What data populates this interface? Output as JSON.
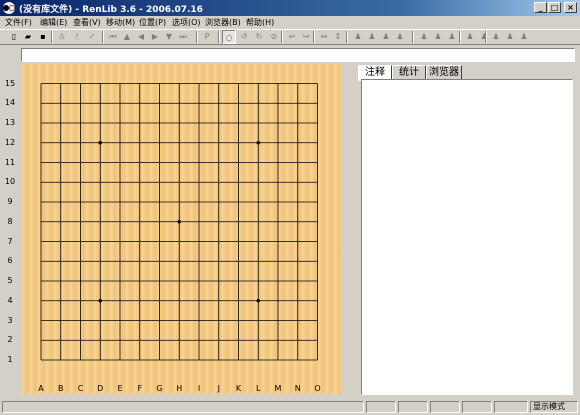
{
  "window": {
    "title": "(没有库文件) - RenLib 3.6 - 2006.07.16"
  },
  "caption_buttons": {
    "minimize": "_",
    "maximize": "□",
    "close": "×"
  },
  "menu": [
    {
      "label": "文件(F)"
    },
    {
      "label": "编辑(E)"
    },
    {
      "label": "查看(V)"
    },
    {
      "label": "移动(M)"
    },
    {
      "label": "位置(P)"
    },
    {
      "label": "选项(O)"
    },
    {
      "label": "浏览器(B)"
    },
    {
      "label": "帮助(H)"
    }
  ],
  "toolbar": {
    "buttons": [
      {
        "icon": "new-file-icon",
        "glyph": "▯",
        "active": true
      },
      {
        "icon": "open-folder-icon",
        "glyph": "▰",
        "active": true
      },
      {
        "icon": "save-disk-icon",
        "glyph": "▪",
        "active": true
      },
      {
        "icon": "black-stone-move-icon",
        "glyph": "♙",
        "active": false
      },
      {
        "icon": "exclamation-icon",
        "glyph": "!",
        "active": false
      },
      {
        "icon": "checkmark-icon",
        "glyph": "✓",
        "active": false
      },
      {
        "icon": "first-move-icon",
        "glyph": "⏮",
        "active": false
      },
      {
        "icon": "arrow-up-icon",
        "glyph": "▲",
        "active": false
      },
      {
        "icon": "arrow-left-icon",
        "glyph": "◀",
        "active": false
      },
      {
        "icon": "arrow-right-icon",
        "glyph": "▶",
        "active": false
      },
      {
        "icon": "arrow-down-icon",
        "glyph": "▼",
        "active": false
      },
      {
        "icon": "last-move-icon",
        "glyph": "⏭",
        "active": false
      },
      {
        "icon": "position-icon",
        "glyph": "P",
        "active": false
      },
      {
        "icon": "rotate-icon",
        "glyph": "◌",
        "active": true,
        "pressed": true
      },
      {
        "icon": "rotate-ccw-icon",
        "glyph": "↺",
        "active": false
      },
      {
        "icon": "rotate-cw-icon",
        "glyph": "↻",
        "active": false
      },
      {
        "icon": "rotate-180-icon",
        "glyph": "⊘",
        "active": false
      },
      {
        "icon": "undo-icon",
        "glyph": "↩",
        "active": false
      },
      {
        "icon": "redo-icon",
        "glyph": "↪",
        "active": false
      },
      {
        "icon": "flip-horizontal-icon",
        "glyph": "↔",
        "active": false
      },
      {
        "icon": "flip-vertical-icon",
        "glyph": "↕",
        "active": false
      },
      {
        "icon": "pattern-1-icon",
        "glyph": "♟",
        "active": false
      },
      {
        "icon": "pattern-2-icon",
        "glyph": "♟",
        "active": false
      },
      {
        "icon": "pattern-3-icon",
        "glyph": "♟",
        "active": false
      },
      {
        "icon": "pattern-4-icon",
        "glyph": "♟",
        "active": false
      },
      {
        "icon": "pattern-5-icon",
        "glyph": "♟",
        "active": false
      },
      {
        "icon": "pattern-6-icon",
        "glyph": "♟",
        "active": false
      },
      {
        "icon": "pattern-7-icon",
        "glyph": "♟",
        "active": false
      },
      {
        "icon": "pattern-8-icon",
        "glyph": "♟",
        "active": false
      },
      {
        "icon": "pattern-9-icon",
        "glyph": "♟",
        "active": false
      },
      {
        "icon": "pattern-10-icon",
        "glyph": "♟",
        "active": false
      },
      {
        "icon": "pattern-11-icon",
        "glyph": "♟",
        "active": false
      },
      {
        "icon": "pattern-12-icon",
        "glyph": "♟",
        "active": false
      }
    ]
  },
  "comment_line": {
    "value": ""
  },
  "board": {
    "size": 15,
    "row_labels": [
      "15",
      "14",
      "13",
      "12",
      "11",
      "10",
      "9",
      "8",
      "7",
      "6",
      "5",
      "4",
      "3",
      "2",
      "1"
    ],
    "col_labels": [
      "A",
      "B",
      "C",
      "D",
      "E",
      "F",
      "G",
      "H",
      "I",
      "J",
      "K",
      "L",
      "M",
      "N",
      "O"
    ],
    "star_points": [
      [
        "D",
        12
      ],
      [
        "L",
        12
      ],
      [
        "H",
        8
      ],
      [
        "D",
        4
      ],
      [
        "L",
        4
      ]
    ],
    "colors": {
      "wood": "#f6cd86",
      "line": "#000000"
    }
  },
  "right_panel": {
    "tabs": [
      {
        "label": "注释",
        "selected": true
      },
      {
        "label": "统计",
        "selected": false
      },
      {
        "label": "浏览器",
        "selected": false
      }
    ],
    "content": ""
  },
  "statusbar": {
    "cells": [
      "",
      "",
      "",
      "",
      "",
      "",
      "显示模式"
    ]
  }
}
